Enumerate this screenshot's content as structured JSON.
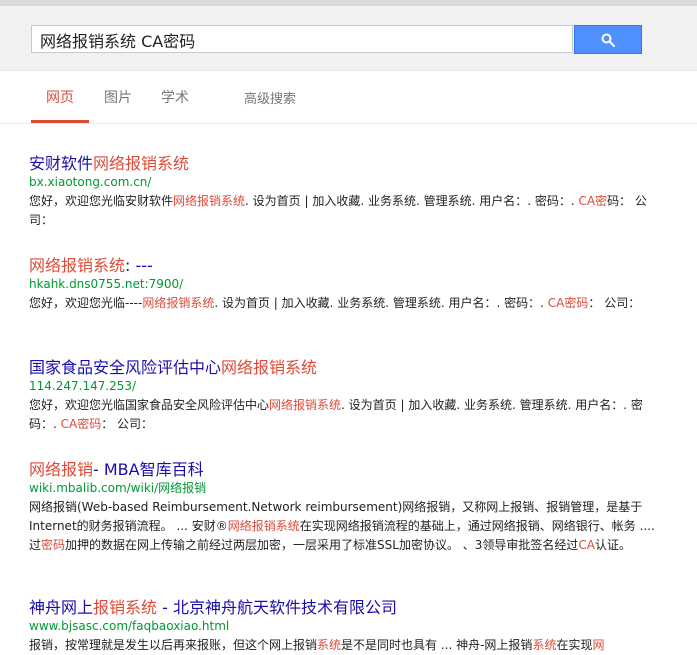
{
  "search": {
    "query": "网络报销系统 CA密码"
  },
  "tabs": {
    "web": "网页",
    "images": "图片",
    "scholar": "学术",
    "advanced": "高级搜索"
  },
  "results": [
    {
      "title_a": "安财软件",
      "title_b": "网络报销系统",
      "url": "bx.xiaotong.com.cn/",
      "s1": "您好，欢迎您光临安财软件",
      "s2": "网络报销系统",
      "s3": ". 设为首页 | 加入收藏. 业务系统. 管理系统. 用户名：. 密码：. ",
      "s4": "CA密",
      "s5": "码： 公司："
    },
    {
      "title_a": "网络报销系统",
      "title_b": ": ---",
      "url": "hkahk.dns0755.net:7900/",
      "s1": "您好，欢迎您光临----",
      "s2": "网络报销系统",
      "s3": ". 设为首页 | 加入收藏. 业务系统. 管理系统. 用户名：. 密码：. ",
      "s4": "CA密码",
      "s5": "： 公司："
    },
    {
      "title_a": "国家食品安全风险评估中心",
      "title_b": "网络报销系统",
      "url": "114.247.147.253/",
      "s1": "您好，欢迎您光临国家食品安全风险评估中心",
      "s2": "网络报销系统",
      "s3": ". 设为首页 | 加入收藏. 业务系统. 管理系统. 用户名：. 密码：. ",
      "s4": "CA密码",
      "s5": "： 公司："
    },
    {
      "title_a": "网络报销",
      "title_b": "- MBA智库百科",
      "url": "wiki.mbalib.com/wiki/网络报销",
      "s1": "网络报销(Web-based Reimbursement.Network reimbursement)网络报销，又称网上报销、报销管理，是基于Internet的财务报销流程。 ... 安财®",
      "s2": "网络报销系统",
      "s3": "在实现网络报销流程的基础上，通过网络报销、网络银行、帐务 .... 过",
      "s4": "密码",
      "s5": "加押的数据在网上传输之前经过两层加密，一层采用了标准SSL加密协议。 、3领导审批签名经过",
      "s6": "CA",
      "s7": "认证。"
    },
    {
      "title_a": "神舟网上",
      "title_b": "报销系统",
      "title_c": " - 北京神舟航天软件技术有限公司",
      "url": "www.bjsasc.com/faqbaoxiao.html",
      "s1": "报销，按常理就是发生以后再来报账，但这个网上报销",
      "s2": "系统",
      "s3": "是不是同时也具有 ... 神舟-网上报销",
      "s4": "系统",
      "s5": "在实现",
      "s6": "网"
    }
  ],
  "colors": {
    "link": "#1a0dab",
    "highlight": "#dd4b39",
    "url": "#009933",
    "button": "#4d90fe"
  }
}
